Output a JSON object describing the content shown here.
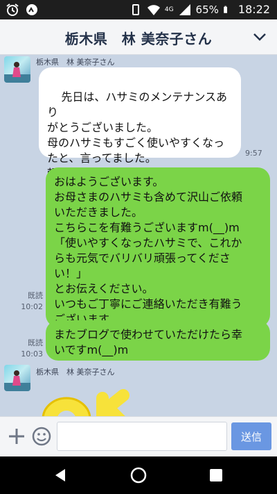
{
  "status_bar": {
    "battery": "65%",
    "time": "18:22",
    "network": "4G"
  },
  "header": {
    "title": "栃木県　林 美奈子さん"
  },
  "chat": {
    "messages": [
      {
        "sender": "栃木県　林 美奈子さん",
        "text": "先日は、ハサミのメンテナンスあり\nがとうございました。\n母のハサミもすごく使いやすくなっ\nたと、言ってました。\n頼んで本当に良かったです。ありが\nとうございました",
        "time": "9:57"
      },
      {
        "text": "おはようございます。\nお母さまのハサミも含めて沢山ご依頼\nいただきました。\nこちらこを有難うございますm(__)m\n「使いやすくなったハサミで、これか\nらも元気でバリバリ頑張ってくださ\nい！」\nとお伝えください。\nいつもご丁寧にご連絡いただき有難う\nございます。",
        "read": "既読",
        "time": "10:02"
      },
      {
        "text": "またブログで使わせていただけたら幸\nいですm(__)m",
        "read": "既読",
        "time": "10:03"
      },
      {
        "sender": "栃木県　林 美奈子さん",
        "sticker": "OK"
      }
    ]
  },
  "input": {
    "placeholder": "",
    "send_label": "送信"
  },
  "colors": {
    "incoming": "#ffffff",
    "outgoing": "#7bd448",
    "background": "#c8d4e4",
    "send": "#6a97e2"
  },
  "icons": [
    "alarm-icon",
    "wifi-icon",
    "signal-icon",
    "battery-icon",
    "chevron-down-icon",
    "plus-icon",
    "emoji-icon",
    "back-icon",
    "home-icon",
    "recent-icon"
  ]
}
